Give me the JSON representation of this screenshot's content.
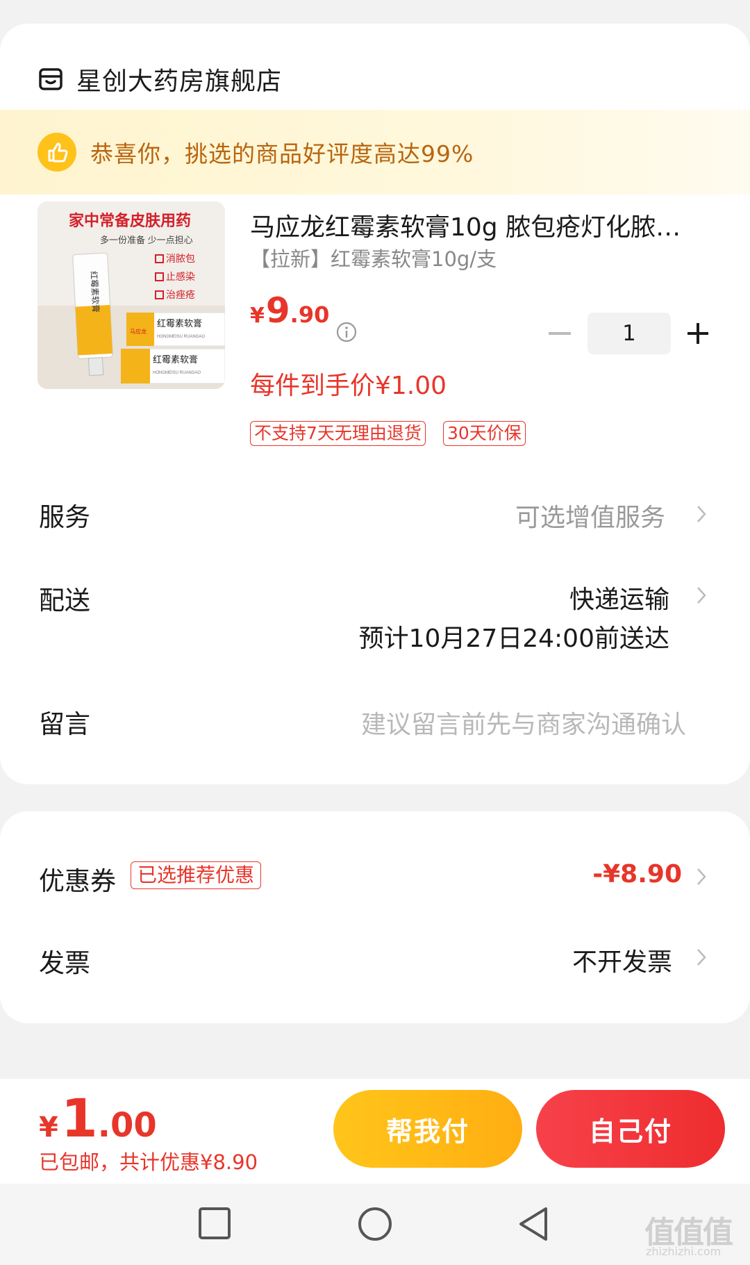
{
  "store": {
    "name": "星创大药房旗舰店",
    "icon": "store-icon"
  },
  "banner": {
    "text": "恭喜你，挑选的商品好评度高达99%",
    "icon": "thumbs-up-icon"
  },
  "product": {
    "image_text": {
      "headline": "家中常备皮肤用药",
      "subline": "多一份准备 少一点担心",
      "bullets": [
        "消脓包",
        "止感染",
        "治痤疮"
      ],
      "box_label": "红霉素软膏",
      "box_pinyin": "HONGMEISU RUANGAO",
      "tube_label": "红霉素软膏",
      "brand": "马应龙"
    },
    "title": "马应龙红霉素软膏10g 脓包疮灯化脓…",
    "spec": "【拉新】红霉素软膏10g/支",
    "price_symbol": "¥",
    "price_int": "9",
    "price_dec": ".90",
    "unit_price": "每件到手价¥1.00",
    "quantity": "1",
    "tags": [
      "不支持7天无理由退货",
      "30天价保"
    ]
  },
  "service": {
    "label": "服务",
    "value": "可选增值服务"
  },
  "delivery": {
    "label": "配送",
    "method": "快递运输",
    "eta": "预计10月27日24:00前送达"
  },
  "message": {
    "label": "留言",
    "placeholder": "建议留言前先与商家沟通确认"
  },
  "coupon": {
    "label": "优惠券",
    "tag": "已选推荐优惠",
    "value": "-¥8.90"
  },
  "invoice": {
    "label": "发票",
    "value": "不开发票"
  },
  "footer": {
    "price_symbol": "¥",
    "price_int": "1",
    "price_dec": ".00",
    "note": "已包邮，共计优惠¥8.90",
    "help_pay": "帮我付",
    "self_pay": "自己付"
  },
  "watermark": {
    "text": "值值值",
    "sub": "zhizhizhi.com"
  },
  "colors": {
    "accent": "#e8352a",
    "banner_text": "#b8650f",
    "yellow_button": "#ffc51a",
    "red_button": "#ee2d2f"
  }
}
